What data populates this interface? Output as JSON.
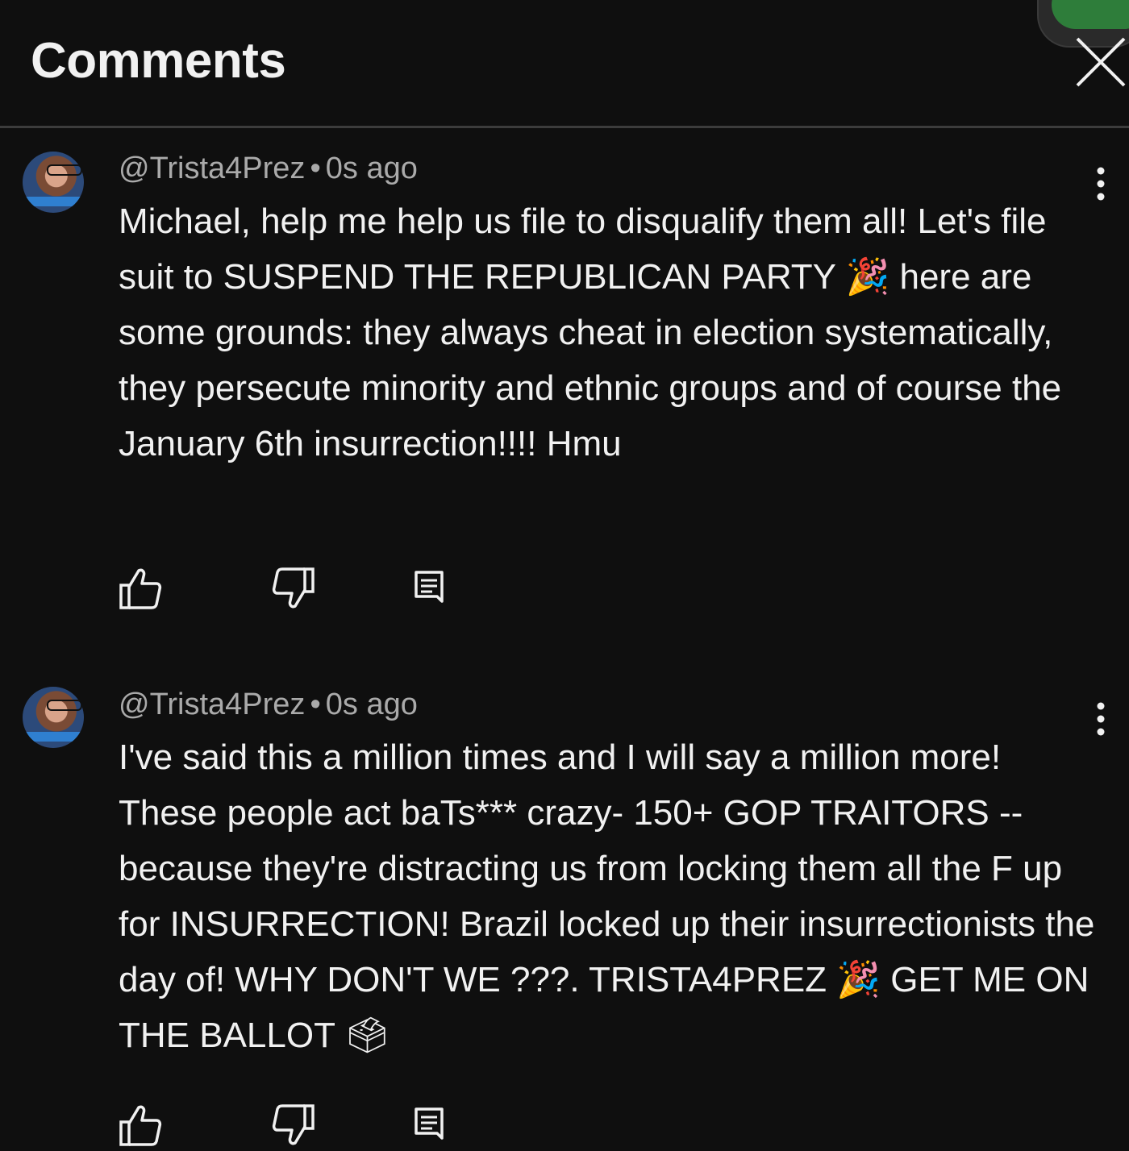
{
  "header": {
    "title": "Comments"
  },
  "comments": [
    {
      "author": "@Trista4Prez",
      "separator": "•",
      "time": "0s ago",
      "text": "Michael, help me help us file to disqualify them all! Let's file suit to SUSPEND THE REPUBLICAN PARTY 🎉 here are some grounds: they always cheat in election systematically, they persecute minority and ethnic groups and of course the January 6th insurrection!!!! Hmu"
    },
    {
      "author": "@Trista4Prez",
      "separator": "•",
      "time": "0s ago",
      "text": "I've said this a million times and I will say a million more! These people act baTs*** crazy- 150+ GOP TRAITORS -- because they're distracting us from locking them all the F up for INSURRECTION! Brazil locked up their insurrectionists the day of! WHY DON'T WE ???. TRISTA4PREZ 🎉 GET ME ON THE BALLOT 🗳"
    }
  ],
  "colors": {
    "background": "#0f0f0f",
    "text": "#f1f1f1",
    "meta": "#aaaaaa",
    "accent_green": "#2e7d3a"
  }
}
